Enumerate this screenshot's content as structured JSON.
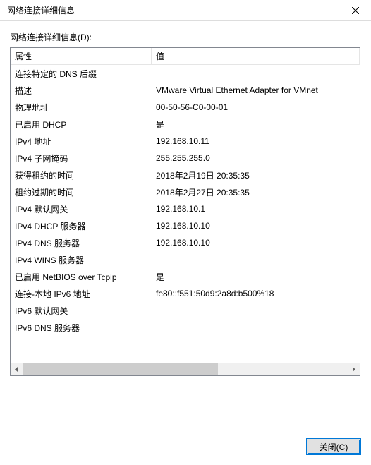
{
  "window": {
    "title": "网络连接详细信息"
  },
  "subtitle": "网络连接详细信息(D):",
  "columns": {
    "property": "属性",
    "value": "值"
  },
  "rows": [
    {
      "prop": "连接特定的 DNS 后缀",
      "val": ""
    },
    {
      "prop": "描述",
      "val": "VMware Virtual Ethernet Adapter for VMnet"
    },
    {
      "prop": "物理地址",
      "val": "00-50-56-C0-00-01"
    },
    {
      "prop": "已启用 DHCP",
      "val": "是"
    },
    {
      "prop": "IPv4 地址",
      "val": "192.168.10.11"
    },
    {
      "prop": "IPv4 子网掩码",
      "val": "255.255.255.0"
    },
    {
      "prop": "获得租约的时间",
      "val": "2018年2月19日 20:35:35"
    },
    {
      "prop": "租约过期的时间",
      "val": "2018年2月27日 20:35:35"
    },
    {
      "prop": "IPv4 默认网关",
      "val": "192.168.10.1"
    },
    {
      "prop": "IPv4 DHCP 服务器",
      "val": "192.168.10.10"
    },
    {
      "prop": "IPv4 DNS 服务器",
      "val": "192.168.10.10"
    },
    {
      "prop": "IPv4 WINS 服务器",
      "val": ""
    },
    {
      "prop": "已启用 NetBIOS over Tcpip",
      "val": "是"
    },
    {
      "prop": "连接-本地 IPv6 地址",
      "val": "fe80::f551:50d9:2a8d:b500%18"
    },
    {
      "prop": "IPv6 默认网关",
      "val": ""
    },
    {
      "prop": "IPv6 DNS 服务器",
      "val": ""
    }
  ],
  "buttons": {
    "close": "关闭(C)"
  }
}
